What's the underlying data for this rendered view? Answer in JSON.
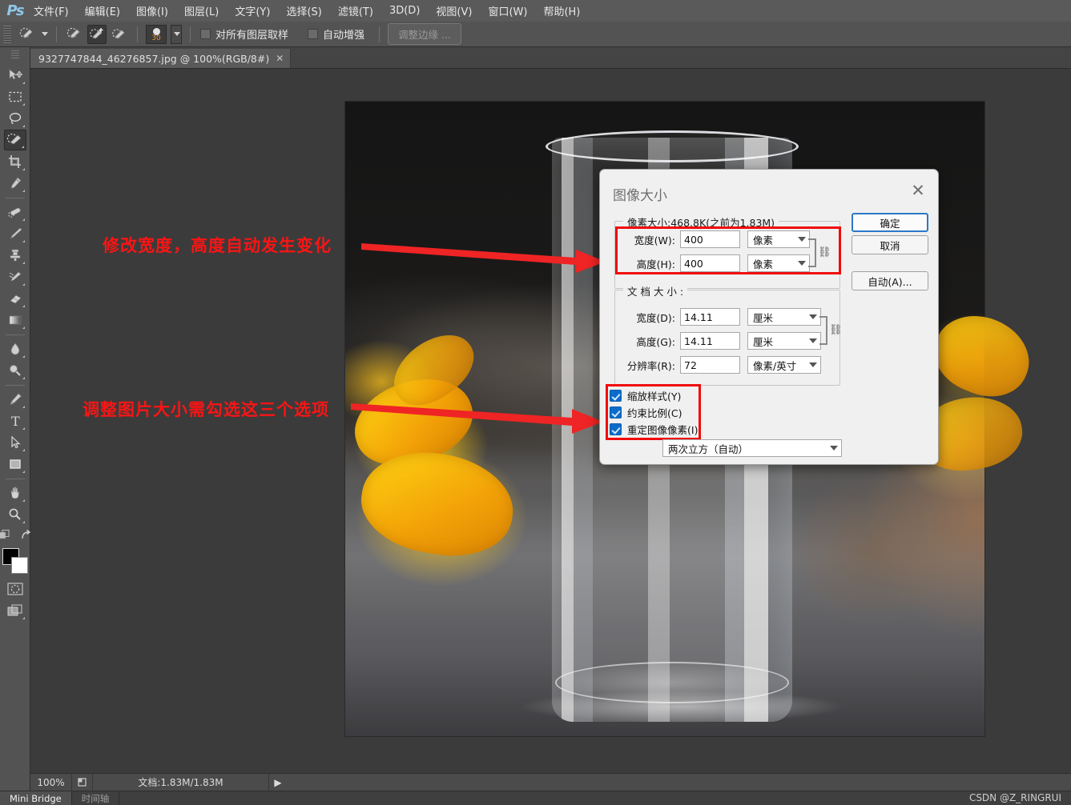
{
  "app": {
    "logo": "Ps",
    "menus": [
      {
        "label": "文件(F)"
      },
      {
        "label": "编辑(E)"
      },
      {
        "label": "图像(I)"
      },
      {
        "label": "图层(L)"
      },
      {
        "label": "文字(Y)"
      },
      {
        "label": "选择(S)"
      },
      {
        "label": "滤镜(T)"
      },
      {
        "label": "3D(D)"
      },
      {
        "label": "视图(V)"
      },
      {
        "label": "窗口(W)"
      },
      {
        "label": "帮助(H)"
      }
    ]
  },
  "options_bar": {
    "brush_size": "30",
    "sample_all_layers_label": "对所有图层取样",
    "auto_enhance_label": "自动增强",
    "refine_edge_label": "调整边缘 ..."
  },
  "document_tab": {
    "title": "9327747844_46276857.jpg @ 100%(RGB/8#)",
    "close": "✕"
  },
  "toolbar": {
    "tools": [
      {
        "name": "move-tool"
      },
      {
        "name": "marquee-tool"
      },
      {
        "name": "lasso-tool"
      },
      {
        "name": "quick-selection-tool"
      },
      {
        "name": "crop-tool"
      },
      {
        "name": "eyedropper-tool"
      },
      {
        "name": "healing-brush-tool"
      },
      {
        "name": "brush-tool"
      },
      {
        "name": "clone-stamp-tool"
      },
      {
        "name": "history-brush-tool"
      },
      {
        "name": "eraser-tool"
      },
      {
        "name": "gradient-tool"
      },
      {
        "name": "blur-tool"
      },
      {
        "name": "dodge-tool"
      },
      {
        "name": "pen-tool"
      },
      {
        "name": "type-tool"
      },
      {
        "name": "path-selection-tool"
      },
      {
        "name": "rectangle-tool"
      },
      {
        "name": "hand-tool"
      },
      {
        "name": "zoom-tool"
      }
    ],
    "foreground_color": "#000000",
    "background_color": "#ffffff"
  },
  "annotations": {
    "note1": "修改宽度，高度自动发生变化",
    "note2": "调整图片大小需勾选这三个选项",
    "color": "#fb1414"
  },
  "dialog": {
    "title": "图像大小",
    "close_label": "✕",
    "pixel_group": {
      "legend": "像素大小:468.8K(之前为1.83M)",
      "width_label": "宽度(W):",
      "width_value": "400",
      "width_unit": "像素",
      "height_label": "高度(H):",
      "height_value": "400",
      "height_unit": "像素"
    },
    "doc_group": {
      "legend": "文 档 大 小 :",
      "width_label": "宽度(D):",
      "width_value": "14.11",
      "width_unit": "厘米",
      "height_label": "高度(G):",
      "height_value": "14.11",
      "height_unit": "厘米",
      "res_label": "分辨率(R):",
      "res_value": "72",
      "res_unit": "像素/英寸"
    },
    "checkboxes": [
      {
        "label": "缩放样式(Y)",
        "checked": true
      },
      {
        "label": "约束比例(C)",
        "checked": true
      },
      {
        "label": "重定图像像素(I):",
        "checked": true
      }
    ],
    "resample_method": "两次立方（自动）",
    "buttons": {
      "ok": "确定",
      "cancel": "取消",
      "auto": "自动(A)..."
    }
  },
  "status_bar": {
    "zoom": "100%",
    "doc_info": "文档:1.83M/1.83M",
    "arrow": "▶"
  },
  "bottom_bar": {
    "tabs": [
      {
        "label": "Mini Bridge",
        "active": true
      },
      {
        "label": "时间轴",
        "active": false
      }
    ],
    "watermark": "CSDN @Z_RINGRUI"
  }
}
